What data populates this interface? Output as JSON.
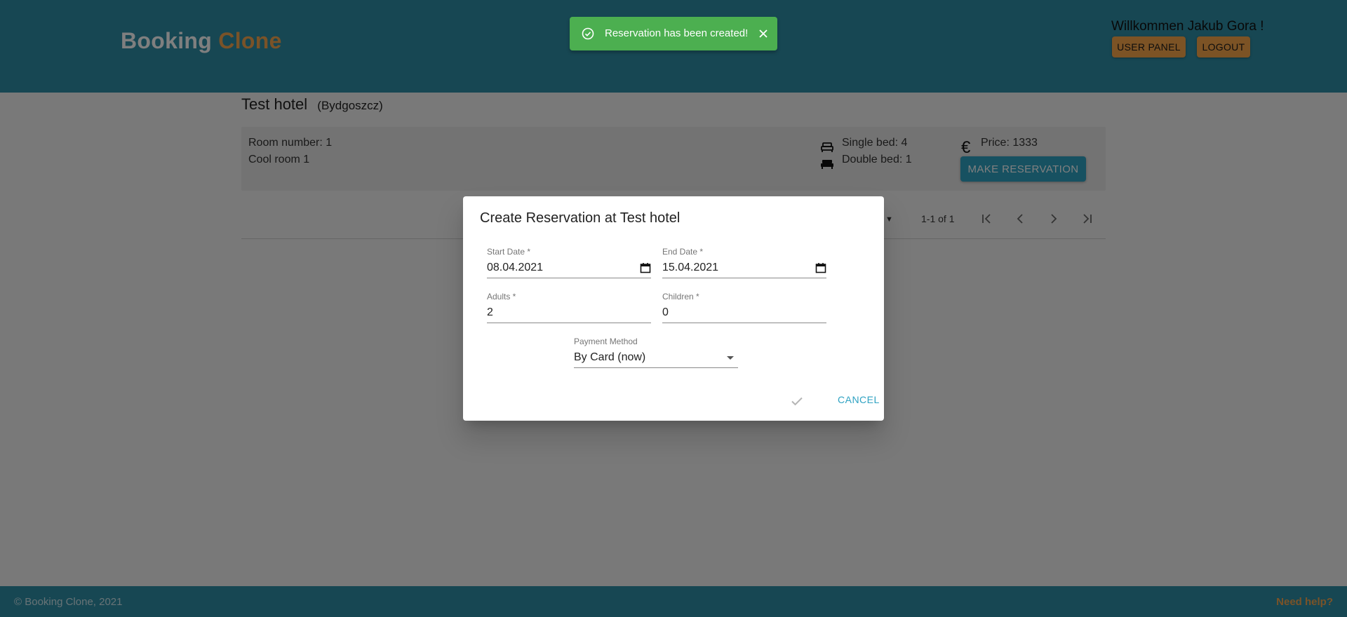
{
  "header": {
    "logo_part1": "Booking",
    "logo_part2": "Clone",
    "welcome": "Willkommen Jakub Gora !",
    "user_panel": "USER PANEL",
    "logout": "LOGOUT"
  },
  "hotel": {
    "name": "Test hotel",
    "city": "(Bydgoszcz)"
  },
  "room": {
    "number": "Room number: 1",
    "name": "Cool room 1",
    "single_bed": "Single bed: 4",
    "double_bed": "Double bed: 1",
    "price": "Price: 1333",
    "currency_symbol": "€",
    "make_reservation": "MAKE RESERVATION"
  },
  "pagination": {
    "range": "1-1 of 1"
  },
  "dialog": {
    "title": "Create Reservation at Test hotel",
    "start_date_label": "Start Date *",
    "start_date_value": "08.04.2021",
    "end_date_label": "End Date *",
    "end_date_value": "15.04.2021",
    "adults_label": "Adults *",
    "adults_value": "2",
    "children_label": "Children *",
    "children_value": "0",
    "payment_label": "Payment Method",
    "payment_value": "By Card (now)",
    "cancel": "CANCEL"
  },
  "toast": {
    "message": "Reservation has been created!"
  },
  "footer": {
    "copyright": "© Booking Clone, 2021",
    "help": "Need help?"
  },
  "colors": {
    "header_bg": "#2e8ea6",
    "accent_orange": "#f8a64a",
    "primary_button": "#2ea2c2",
    "toast_success": "#4caf50"
  }
}
